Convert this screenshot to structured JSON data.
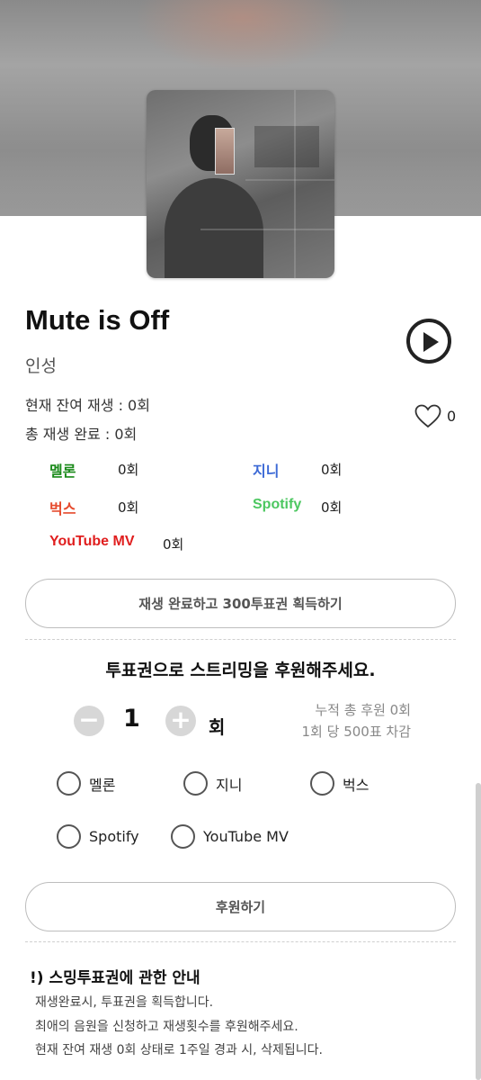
{
  "song": {
    "title": "Mute is Off",
    "artist": "인성"
  },
  "stats": {
    "remaining": "현재 잔여 재생 : 0회",
    "completed": "총 재생 완료 : 0회",
    "likes": "0"
  },
  "platforms": [
    {
      "name": "멜론",
      "count": "0회",
      "color": "#1a8a1a"
    },
    {
      "name": "지니",
      "count": "0회",
      "color": "#3d6ad6"
    },
    {
      "name": "벅스",
      "count": "0회",
      "color": "#e64b2e"
    },
    {
      "name": "Spotify",
      "count": "0회",
      "color": "#4cc760"
    },
    {
      "name": "YouTube MV",
      "count": "0회",
      "color": "#e01e1e"
    }
  ],
  "earn_button": "재생 완료하고 300투표권 획득하기",
  "support": {
    "heading": "투표권으로 스트리밍을 후원해주세요.",
    "minus": "−",
    "plus": "+",
    "quantity": "1",
    "unit": "회",
    "note_total": "누적 총 후원 0회",
    "note_cost": "1회 당 500표 차감",
    "options": [
      "멜론",
      "지니",
      "벅스",
      "Spotify",
      "YouTube MV"
    ],
    "submit": "후원하기"
  },
  "notice": {
    "title": "!) 스밍투표권에 관한 안내",
    "lines": [
      "재생완료시, 투표권을 획득합니다.",
      "최애의 음원을 신청하고 재생횟수를 후원해주세요.",
      "현재 잔여 재생 0회 상태로 1주일 경과 시, 삭제됩니다."
    ]
  },
  "icons": {
    "play": "play-icon",
    "heart": "heart-icon"
  }
}
